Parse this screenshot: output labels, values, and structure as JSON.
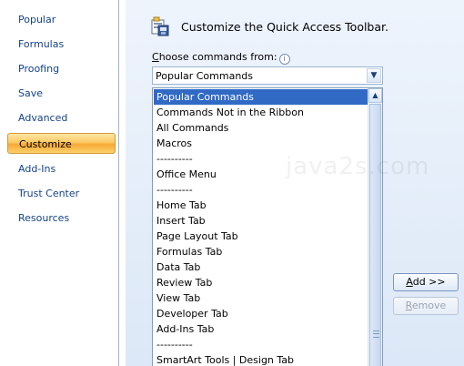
{
  "nav": {
    "items": [
      {
        "label": "Popular"
      },
      {
        "label": "Formulas"
      },
      {
        "label": "Proofing"
      },
      {
        "label": "Save"
      },
      {
        "label": "Advanced"
      },
      {
        "label": "Customize"
      },
      {
        "label": "Add-Ins"
      },
      {
        "label": "Trust Center"
      },
      {
        "label": "Resources"
      }
    ],
    "active": "Customize"
  },
  "header": {
    "title": "Customize the Quick Access Toolbar.",
    "icon": "toolbar-customize-icon"
  },
  "choose": {
    "label_accel": "C",
    "label_rest": "hoose commands from:",
    "info_glyph": "i"
  },
  "combo": {
    "value": "Popular Commands",
    "arrow_glyph": "▼"
  },
  "list": {
    "items": [
      "Popular Commands",
      "Commands Not in the Ribbon",
      "All Commands",
      "Macros",
      "----------",
      "Office Menu",
      "----------",
      "Home Tab",
      "Insert Tab",
      "Page Layout Tab",
      "Formulas Tab",
      "Data Tab",
      "Review Tab",
      "View Tab",
      "Developer Tab",
      "Add-Ins Tab",
      "----------",
      "SmartArt Tools | Design Tab"
    ],
    "selected_index": 0,
    "scroll_up_glyph": "▲"
  },
  "buttons": {
    "add_accel": "A",
    "add_rest": "dd >>",
    "remove_accel": "R",
    "remove_rest": "emove"
  },
  "watermark": "java2s.com",
  "colors": {
    "nav_text": "#15428b",
    "selection": "#316ac5",
    "active_tab": "#f8a935"
  }
}
